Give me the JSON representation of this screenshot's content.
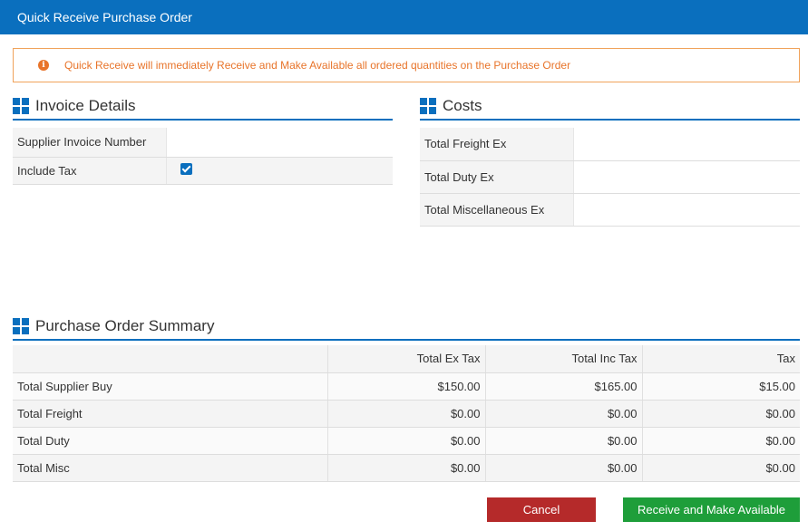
{
  "dialog": {
    "title": "Quick Receive Purchase Order"
  },
  "notice": {
    "icon": "info-circle-icon",
    "text": "Quick Receive will immediately Receive and Make Available all ordered quantities on the Purchase Order",
    "color": "#e8742a"
  },
  "invoice": {
    "title": "Invoice Details",
    "supplier_invoice_label": "Supplier Invoice Number",
    "supplier_invoice_value": "",
    "include_tax_label": "Include Tax",
    "include_tax_checked": true
  },
  "costs": {
    "title": "Costs",
    "freight_label": "Total Freight Ex",
    "freight_value": "",
    "duty_label": "Total Duty Ex",
    "duty_value": "",
    "misc_label": "Total Miscellaneous Ex",
    "misc_value": ""
  },
  "summary": {
    "title": "Purchase Order Summary",
    "columns": [
      "",
      "Total Ex Tax",
      "Total Inc Tax",
      "Tax"
    ],
    "rows": [
      {
        "label": "Total Supplier Buy",
        "ex_tax": "$150.00",
        "inc_tax": "$165.00",
        "tax": "$15.00"
      },
      {
        "label": "Total Freight",
        "ex_tax": "$0.00",
        "inc_tax": "$0.00",
        "tax": "$0.00"
      },
      {
        "label": "Total Duty",
        "ex_tax": "$0.00",
        "inc_tax": "$0.00",
        "tax": "$0.00"
      },
      {
        "label": "Total Misc",
        "ex_tax": "$0.00",
        "inc_tax": "$0.00",
        "tax": "$0.00"
      }
    ]
  },
  "actions": {
    "cancel_label": "Cancel",
    "receive_label": "Receive and Make Available"
  },
  "colors": {
    "accent": "#0a6fbe",
    "cancel": "#b52a2a",
    "confirm": "#1e9e3a",
    "warning": "#e8742a"
  }
}
